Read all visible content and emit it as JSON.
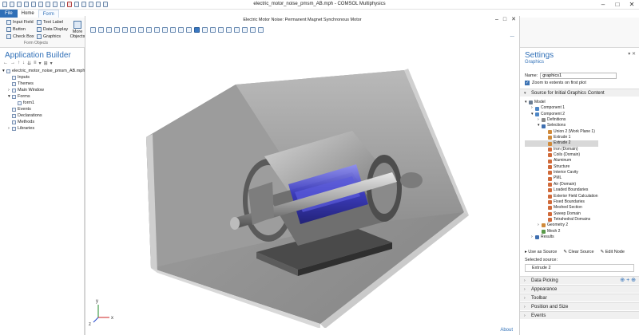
{
  "window": {
    "title": "electric_motor_noise_pmsm_AB.mph - COMSOL Multiphysics",
    "controls": [
      "–",
      "□",
      "✕"
    ]
  },
  "ribbon": {
    "tabs": [
      "File",
      "Home",
      "Form"
    ],
    "group_label": "Form Objects",
    "items": [
      "Input Field",
      "Text Label",
      "Button",
      "Data Display",
      "Check Box",
      "Graphics"
    ],
    "more_objects": [
      "More",
      "Objects"
    ]
  },
  "application_builder": {
    "title": "Application Builder",
    "toolbar": [
      "←",
      "→",
      "↑",
      "↓",
      "⇊",
      "≡",
      "▾",
      "⊞",
      "▾"
    ],
    "tree": [
      {
        "label": "electric_motor_noise_pmsm_AB.mph",
        "indent": 0,
        "exp": "▾",
        "icon": "file-icon"
      },
      {
        "label": "Inputs",
        "indent": 1,
        "exp": "",
        "icon": "inputs-icon"
      },
      {
        "label": "Themes",
        "indent": 1,
        "exp": "",
        "icon": "themes-icon"
      },
      {
        "label": "Main Window",
        "indent": 1,
        "exp": "›",
        "icon": "window-icon"
      },
      {
        "label": "Forms",
        "indent": 1,
        "exp": "▾",
        "icon": "forms-icon"
      },
      {
        "label": "form1",
        "indent": 2,
        "exp": "",
        "icon": "form-icon"
      },
      {
        "label": "Events",
        "indent": 1,
        "exp": "",
        "icon": "events-icon"
      },
      {
        "label": "Declarations",
        "indent": 1,
        "exp": "",
        "icon": "declarations-icon"
      },
      {
        "label": "Methods",
        "indent": 1,
        "exp": "",
        "icon": "methods-icon"
      },
      {
        "label": "Libraries",
        "indent": 1,
        "exp": "›",
        "icon": "libraries-icon"
      }
    ]
  },
  "graphics_window": {
    "title": "Electric Motor Noise: Permanent Magnet Synchronous Motor",
    "controls": [
      "–",
      "□",
      "✕"
    ],
    "about": "About",
    "axis_labels": {
      "x": "x",
      "y": "y",
      "z": "z"
    }
  },
  "settings": {
    "title": "Settings",
    "subtitle": "Graphics",
    "name_label": "Name:",
    "name_value": "graphics1",
    "zoom_label": "Zoom to extents on first plot",
    "source_section": "Source for Initial Graphics Content",
    "source_tree": [
      {
        "label": "Model",
        "indent": 0,
        "exp": "▾",
        "color": "#6b7d93"
      },
      {
        "label": "Component 1",
        "indent": 1,
        "exp": "›",
        "color": "#4d86c6"
      },
      {
        "label": "Component 2",
        "indent": 1,
        "exp": "▾",
        "color": "#4d86c6"
      },
      {
        "label": "Definitions",
        "indent": 2,
        "exp": "›",
        "color": "#8a8a8a"
      },
      {
        "label": "Selections",
        "indent": 2,
        "exp": "▾",
        "color": "#3f6fb0"
      },
      {
        "label": "Union 2 (Work Plane 1)",
        "indent": 3,
        "exp": "",
        "color": "#d08a3a"
      },
      {
        "label": "Extrude 1",
        "indent": 3,
        "exp": "",
        "color": "#d08a3a"
      },
      {
        "label": "Extrude 2",
        "indent": 3,
        "exp": "",
        "color": "#d08a3a",
        "selected": true
      },
      {
        "label": "Iron (Domain)",
        "indent": 3,
        "exp": "",
        "color": "#d06a3a"
      },
      {
        "label": "Coils (Domain)",
        "indent": 3,
        "exp": "",
        "color": "#d06a3a"
      },
      {
        "label": "Aluminum",
        "indent": 3,
        "exp": "",
        "color": "#d06a3a"
      },
      {
        "label": "Structure",
        "indent": 3,
        "exp": "",
        "color": "#d06a3a"
      },
      {
        "label": "Interior Cavity",
        "indent": 3,
        "exp": "",
        "color": "#d06a3a"
      },
      {
        "label": "PML",
        "indent": 3,
        "exp": "",
        "color": "#d06a3a"
      },
      {
        "label": "Air (Domain)",
        "indent": 3,
        "exp": "",
        "color": "#d06a3a"
      },
      {
        "label": "Loaded Boundaries",
        "indent": 3,
        "exp": "",
        "color": "#d06a3a"
      },
      {
        "label": "Exterior Field Calculation",
        "indent": 3,
        "exp": "",
        "color": "#d06a3a"
      },
      {
        "label": "Fixed Boundaries",
        "indent": 3,
        "exp": "",
        "color": "#d06a3a"
      },
      {
        "label": "Meshed Section",
        "indent": 3,
        "exp": "",
        "color": "#d06a3a"
      },
      {
        "label": "Sweep Domain",
        "indent": 3,
        "exp": "",
        "color": "#d06a3a"
      },
      {
        "label": "Tetrahedral Domains",
        "indent": 3,
        "exp": "",
        "color": "#d06a3a"
      },
      {
        "label": "Geometry 2",
        "indent": 2,
        "exp": "›",
        "color": "#d08a3a"
      },
      {
        "label": "Mesh 2",
        "indent": 2,
        "exp": "",
        "color": "#5a9a4a"
      },
      {
        "label": "Results",
        "indent": 1,
        "exp": "›",
        "color": "#3f6fb0"
      }
    ],
    "actions": [
      "Use as Source",
      "Clear Source",
      "Edit Node"
    ],
    "selected_source_label": "Selected source:",
    "selected_source_value": "Extrude 2",
    "collapsed_sections": [
      "Data Picking",
      "Appearance",
      "Toolbar",
      "Position and Size",
      "Events"
    ]
  }
}
